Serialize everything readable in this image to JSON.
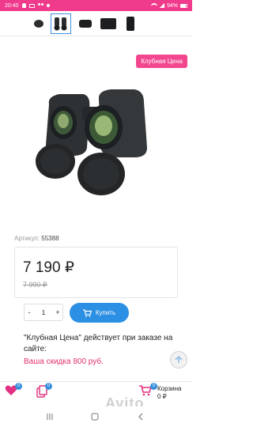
{
  "status_bar": {
    "time": "20:40",
    "battery": "94%"
  },
  "product": {
    "badge": "Клубная Цена",
    "sku_label": "Артикул:",
    "sku_value": "55388",
    "price": "7 190 ₽",
    "old_price": "7 990 ₽"
  },
  "cart_controls": {
    "minus": "-",
    "quantity": "1",
    "plus": "+",
    "buy_label": "Купить"
  },
  "club_note": "\"Клубная Цена\" действует при заказе на сайте:",
  "discount": "Ваша скидка 800 руб.",
  "bottom_bar": {
    "favorites_count": "0",
    "compare_count": "0",
    "cart_count": "0",
    "cart_label": "Корзина",
    "cart_total": "0 ₽"
  },
  "watermark": "Avito",
  "colors": {
    "accent_pink": "#f03a8c",
    "buy_blue": "#2b8fe3",
    "discount_red": "#e0306f"
  }
}
